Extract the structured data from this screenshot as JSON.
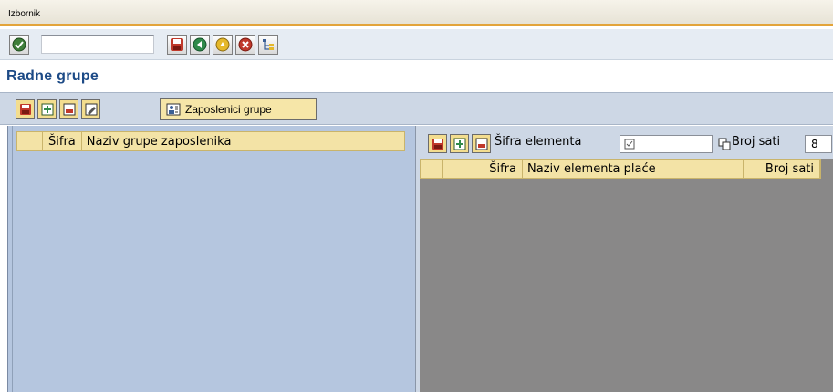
{
  "menu": {
    "label": "Izbornik"
  },
  "toolbar": {
    "command_value": "",
    "icons": [
      "checkmark-icon",
      "save-icon",
      "back-icon",
      "exit-icon",
      "cancel-icon",
      "tree-icon"
    ]
  },
  "page": {
    "title": "Radne grupe"
  },
  "app_toolbar": {
    "icons": [
      "save-icon",
      "add-row-icon",
      "delete-row-icon",
      "edit-icon"
    ],
    "zaposlenici_label": "Zaposlenici grupe"
  },
  "left_table": {
    "columns": [
      "Šifra",
      "Naziv grupe zaposlenika"
    ]
  },
  "right_toolbar": {
    "sifra_label": "Šifra elementa",
    "sifra_value": "",
    "broj_label": "Broj sati",
    "broj_value": "8"
  },
  "right_table": {
    "columns": [
      "Šifra",
      "Naziv elementa plaće",
      "Broj sati"
    ]
  },
  "colors": {
    "accent_orange": "#e3a43a",
    "title_blue": "#1c4a86",
    "panel_blue": "#b5c6df",
    "header_yellow": "#f3e3a6",
    "grid_gray": "#898888"
  }
}
